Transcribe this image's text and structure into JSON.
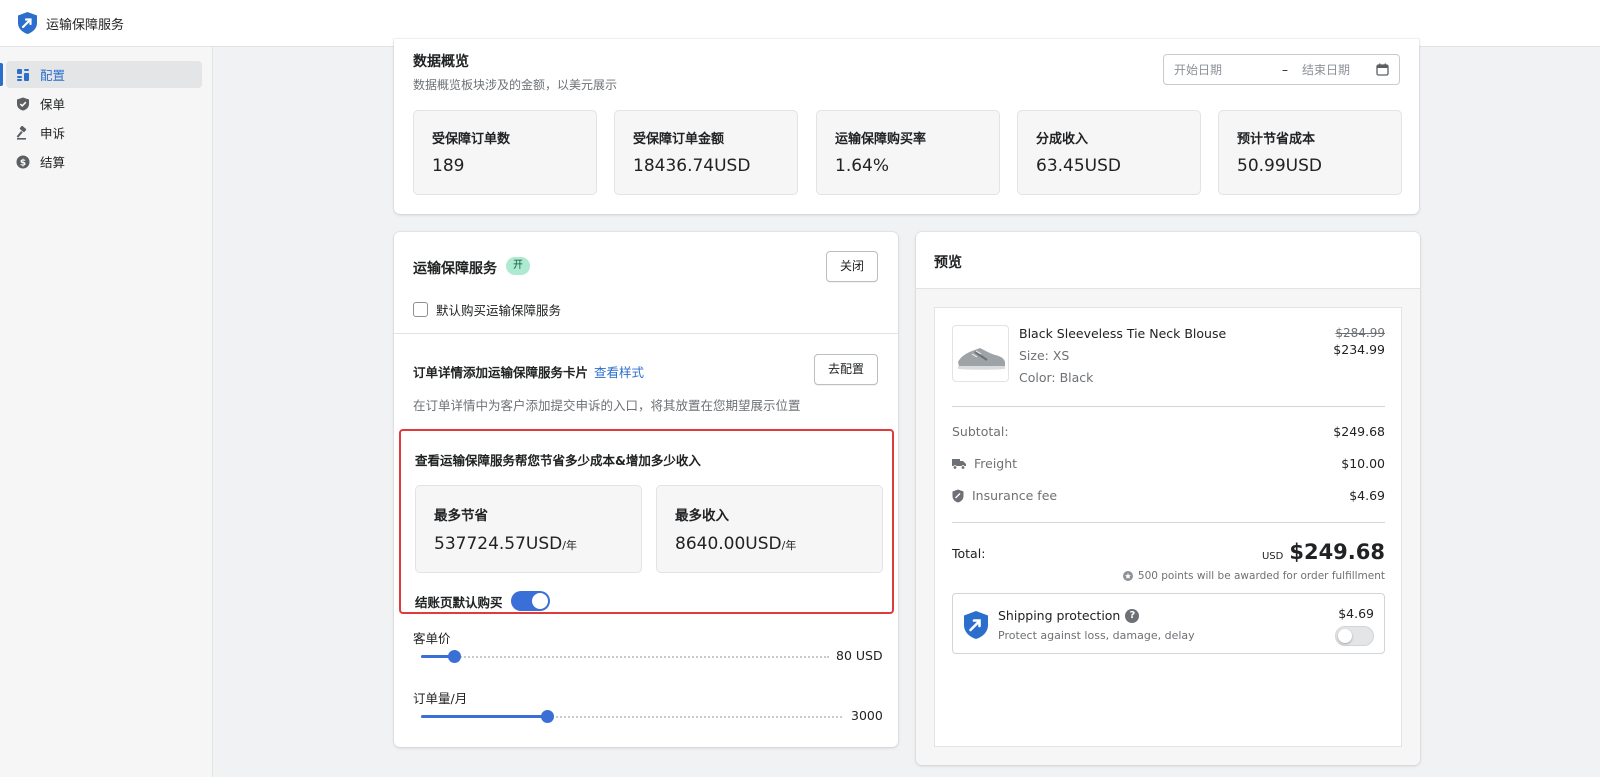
{
  "app": {
    "title": "运输保障服务"
  },
  "sidebar": {
    "items": [
      {
        "label": "配置",
        "icon": "dashboard-icon",
        "active": true
      },
      {
        "label": "保单",
        "icon": "shield-check-icon"
      },
      {
        "label": "申诉",
        "icon": "gavel-icon"
      },
      {
        "label": "结算",
        "icon": "dollar-icon"
      }
    ]
  },
  "overview": {
    "title": "数据概览",
    "subtitle": "数据概览板块涉及的金额，以美元展示",
    "date_start_placeholder": "开始日期",
    "date_separator": "–",
    "date_end_placeholder": "结束日期",
    "stats": [
      {
        "label": "受保障订单数",
        "value": "189"
      },
      {
        "label": "受保障订单金额",
        "value": "18436.74USD"
      },
      {
        "label": "运输保障购买率",
        "value": "1.64%"
      },
      {
        "label": "分成收入",
        "value": "63.45USD"
      },
      {
        "label": "预计节省成本",
        "value": "50.99USD"
      }
    ]
  },
  "service": {
    "title": "运输保障服务",
    "badge": "开",
    "close_button": "关闭",
    "default_checkbox_label": "默认购买运输保障服务",
    "card_title": "订单详情添加运输保障服务卡片",
    "card_link": "查看样式",
    "configure_button": "去配置",
    "card_desc": "在订单详情中为客户添加提交申诉的入口，将其放置在您期望展示位置",
    "calc_title": "查看运输保障服务帮您节省多少成本&增加多少收入",
    "max_save_label": "最多节省",
    "max_save_value": "537724.57USD",
    "max_income_label": "最多收入",
    "max_income_value": "8640.00USD",
    "per_year": "/年",
    "checkout_default_label": "结账页默认购买",
    "checkout_default_on": true,
    "aov_label": "客单价",
    "aov_value": "80 USD",
    "aov_fraction": 0.08,
    "orders_label": "订单量/月",
    "orders_value": "3000",
    "orders_fraction": 0.3
  },
  "preview": {
    "title": "预览",
    "product": {
      "name": "Black Sleeveless Tie Neck Blouse",
      "size": "Size: XS",
      "color": "Color: Black",
      "old_price": "$284.99",
      "price": "$234.99"
    },
    "subtotal_label": "Subtotal:",
    "subtotal_value": "$249.68",
    "freight_label": "Freight",
    "freight_value": "$10.00",
    "insurance_label": "Insurance fee",
    "insurance_value": "$4.69",
    "total_label": "Total:",
    "total_currency": "USD",
    "total_value": "$249.68",
    "points_text": "500 points will be awarded for order fulfillment",
    "shipping": {
      "title": "Shipping protection",
      "desc": "Protect against loss, damage, delay",
      "price": "$4.69",
      "enabled": false
    }
  },
  "colors": {
    "accent": "#3a6fd8",
    "link": "#2c6ecb",
    "badge_bg": "#aee9d1",
    "highlight_border": "#e03b3b"
  }
}
